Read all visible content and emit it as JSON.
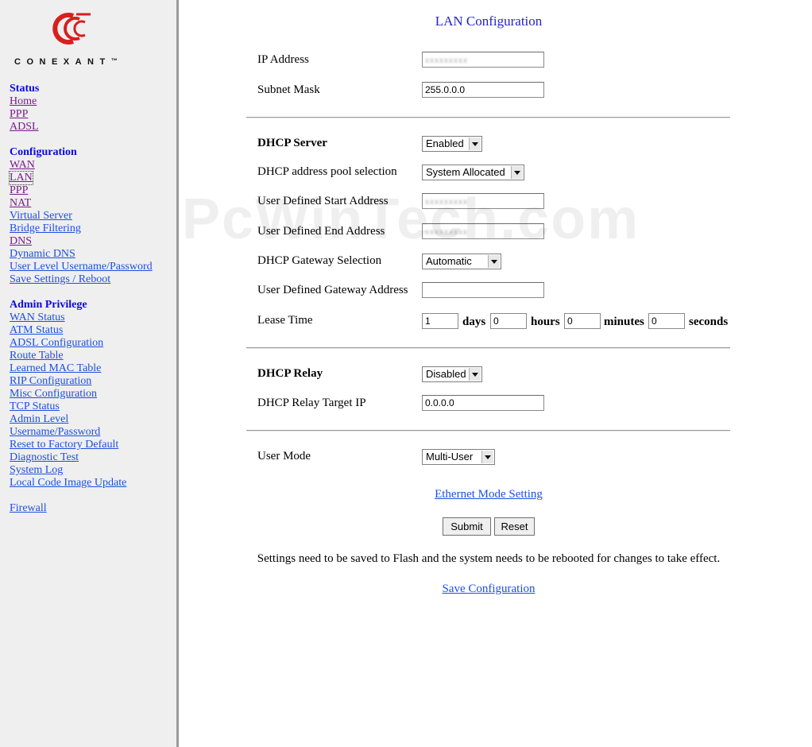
{
  "logo": {
    "text": "CONEXANT",
    "trademark": "™",
    "color_outer": "#d81e1e"
  },
  "sidebar": {
    "status_heading": "Status",
    "status_links": [
      "Home",
      "PPP",
      "ADSL"
    ],
    "config_heading": "Configuration",
    "config_links": [
      "WAN",
      "LAN",
      "PPP",
      "NAT",
      "Virtual Server",
      "Bridge Filtering",
      "DNS",
      "Dynamic DNS",
      "User Level Username/Password",
      "Save Settings / Reboot"
    ],
    "admin_heading": "Admin Privilege",
    "admin_links": [
      "WAN Status",
      "ATM Status",
      "ADSL Configuration",
      "Route Table",
      "Learned MAC Table",
      "RIP Configuration",
      "Misc Configuration",
      "TCP Status",
      "Admin Level",
      "Username/Password",
      "Reset to Factory Default",
      "Diagnostic Test",
      "System Log",
      "Local Code Image Update"
    ],
    "firewall_link": "Firewall"
  },
  "page": {
    "title": "LAN Configuration",
    "ip_address_label": "IP Address",
    "subnet_mask_label": "Subnet Mask",
    "subnet_mask_value": "255.0.0.0",
    "dhcp_server_label": "DHCP Server",
    "dhcp_server_value": "Enabled",
    "pool_label": "DHCP address pool selection",
    "pool_value": "System Allocated",
    "start_label": "User Defined Start Address",
    "end_label": "User Defined End Address",
    "gateway_sel_label": "DHCP Gateway Selection",
    "gateway_sel_value": "Automatic",
    "gateway_addr_label": "User Defined Gateway Address",
    "gateway_addr_value": "",
    "lease_label": "Lease Time",
    "lease_days": "1",
    "lease_hours": "0",
    "lease_minutes": "0",
    "lease_seconds": "0",
    "unit_days": "days",
    "unit_hours": "hours",
    "unit_minutes": "minutes",
    "unit_seconds": "seconds",
    "relay_label": "DHCP Relay",
    "relay_value": "Disabled",
    "relay_target_label": "DHCP Relay Target IP",
    "relay_target_value": "0.0.0.0",
    "user_mode_label": "User Mode",
    "user_mode_value": "Multi-User",
    "ethernet_link": "Ethernet Mode Setting",
    "submit": "Submit",
    "reset": "Reset",
    "note": "Settings need to be saved to Flash and the system needs to be rebooted for changes to take effect.",
    "save_link": "Save Configuration"
  },
  "watermark": "PcWinTech.com"
}
